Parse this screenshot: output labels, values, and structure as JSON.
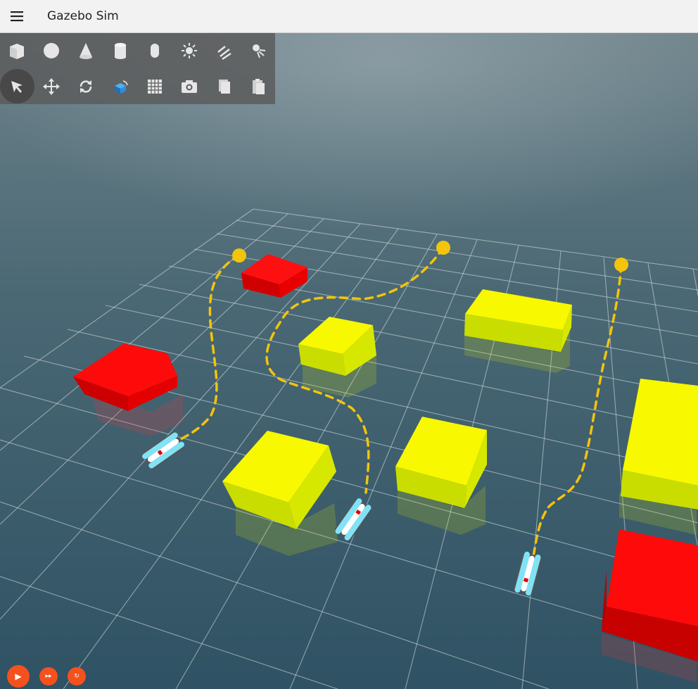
{
  "app": {
    "title": "Gazebo Sim"
  },
  "toolbar": {
    "shapes": [
      "box-icon",
      "sphere-icon",
      "cone-icon",
      "cylinder-icon",
      "capsule-icon",
      "point-light-icon",
      "directional-light-icon",
      "spot-light-icon"
    ],
    "transform": [
      "select-icon",
      "translate-icon",
      "rotate-icon",
      "view-angle-icon",
      "grid-snap-icon",
      "screenshot-icon",
      "copy-icon",
      "paste-icon"
    ]
  },
  "playback": {
    "play": "▶",
    "step": "▸▸",
    "reset": "↻"
  },
  "colors": {
    "accent": "#f4511e",
    "path": "#f2c40c",
    "yellow_box": "#f6f600",
    "red_box": "#e00000",
    "water": "#3d5a68"
  }
}
